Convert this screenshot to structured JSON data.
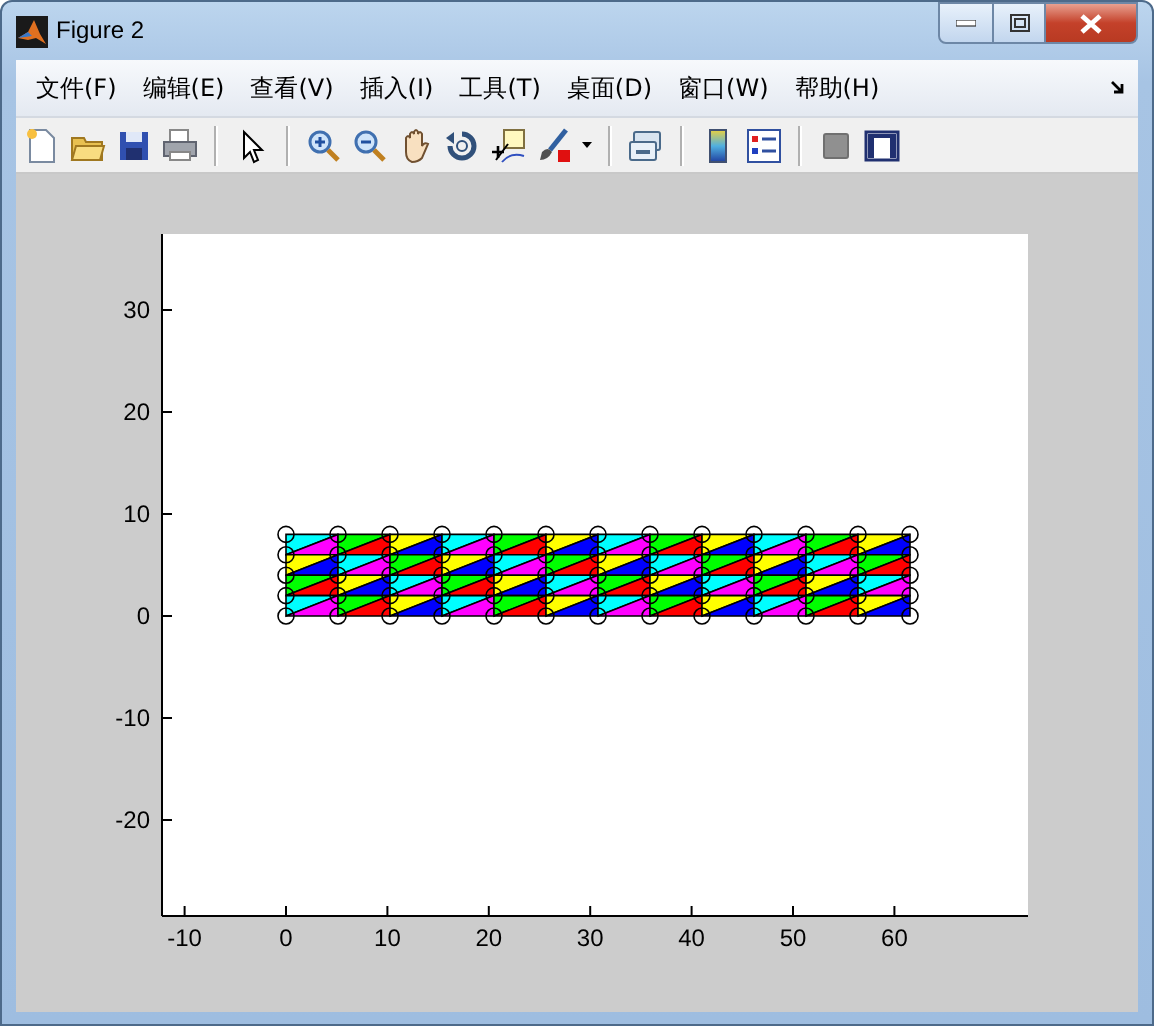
{
  "window": {
    "title": "Figure 2"
  },
  "menu": [
    {
      "label": "文件(F)"
    },
    {
      "label": "编辑(E)"
    },
    {
      "label": "查看(V)"
    },
    {
      "label": "插入(I)"
    },
    {
      "label": "工具(T)"
    },
    {
      "label": "桌面(D)"
    },
    {
      "label": "窗口(W)"
    },
    {
      "label": "帮助(H)"
    }
  ],
  "axes": {
    "xticks": [
      "-10",
      "0",
      "10",
      "20",
      "30",
      "40",
      "50",
      "60"
    ],
    "yticks": [
      "30",
      "20",
      "10",
      "0",
      "-10",
      "-20"
    ]
  }
}
